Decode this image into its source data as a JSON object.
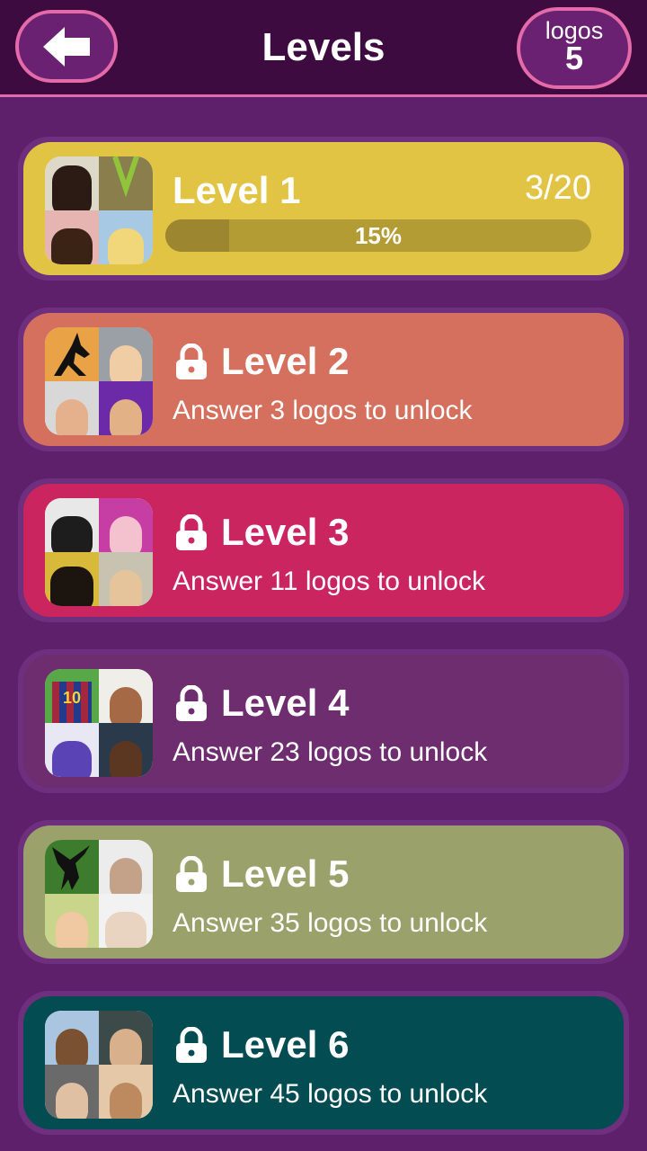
{
  "header": {
    "title": "Levels",
    "logos_label": "logos",
    "logos_count": "5",
    "back_icon": "arrow-left-icon"
  },
  "levels": [
    {
      "title": "Level 1",
      "score": "3/20",
      "percent_label": "15%",
      "progress": 0.15,
      "locked": false,
      "color": "#e2c444"
    },
    {
      "title": "Level 2",
      "subtitle": "Answer 3 logos to unlock",
      "locked": true,
      "color": "#d4705d"
    },
    {
      "title": "Level 3",
      "subtitle": "Answer 11 logos to unlock",
      "locked": true,
      "color": "#cb2560"
    },
    {
      "title": "Level 4",
      "subtitle": "Answer 23 logos to unlock",
      "locked": true,
      "color": "#6e2d6f"
    },
    {
      "title": "Level 5",
      "subtitle": "Answer 35 logos to unlock",
      "locked": true,
      "color": "#9aa16b"
    },
    {
      "title": "Level 6",
      "subtitle": "Answer 45 logos to unlock",
      "locked": true,
      "color": "#034c51"
    }
  ]
}
